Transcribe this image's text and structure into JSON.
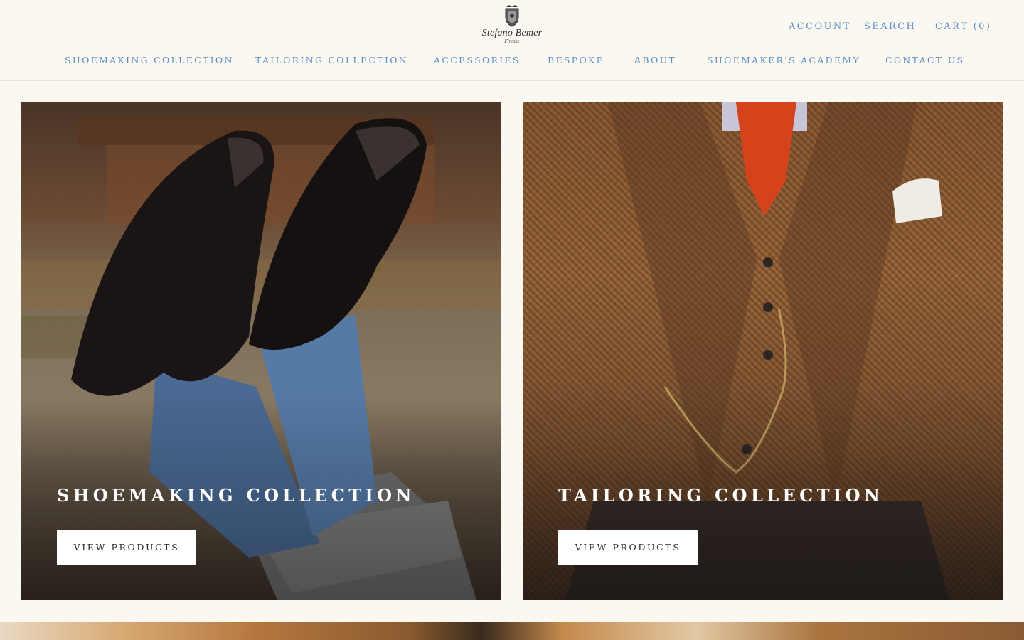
{
  "brand": {
    "name": "Stefano Bemer",
    "city": "Firenze"
  },
  "utility_nav": {
    "account": "ACCOUNT",
    "search": "SEARCH",
    "cart": "CART (0)"
  },
  "main_nav": [
    {
      "label": "SHOEMAKING COLLECTION"
    },
    {
      "label": "TAILORING COLLECTION"
    },
    {
      "label": "ACCESSORIES"
    },
    {
      "label": "BESPOKE"
    },
    {
      "label": "ABOUT"
    },
    {
      "label": "SHOEMAKER'S ACADEMY"
    },
    {
      "label": "CONTACT US"
    }
  ],
  "collections": [
    {
      "title": "SHOEMAKING COLLECTION",
      "button": "VIEW PRODUCTS",
      "image": "black-brogue-shoes-blue-socks"
    },
    {
      "title": "TAILORING COLLECTION",
      "button": "VIEW PRODUCTS",
      "image": "houndstooth-three-piece-suit"
    }
  ],
  "colors": {
    "page_bg": "#fbf8f2",
    "link": "#5b8ec7",
    "button_bg": "#ffffff",
    "button_text": "#2a2a2a",
    "title_text": "#ffffff"
  }
}
